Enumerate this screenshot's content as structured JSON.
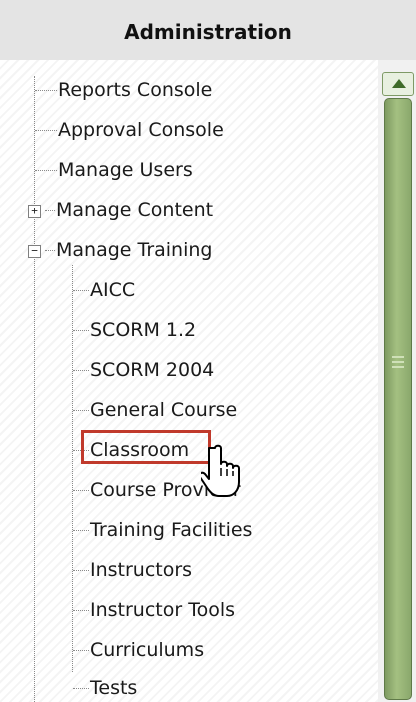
{
  "panel": {
    "title": "Administration"
  },
  "tree": {
    "items": [
      {
        "label": "Reports Console"
      },
      {
        "label": "Approval Console"
      },
      {
        "label": "Manage Users"
      },
      {
        "label": "Manage Content",
        "expander": "+"
      },
      {
        "label": "Manage Training",
        "expander": "−"
      },
      {
        "label": "AICC"
      },
      {
        "label": "SCORM 1.2"
      },
      {
        "label": "SCORM 2004"
      },
      {
        "label": "General Course"
      },
      {
        "label": "Classroom",
        "selected": true
      },
      {
        "label": "Course Provider"
      },
      {
        "label": "Training Facilities"
      },
      {
        "label": "Instructors"
      },
      {
        "label": "Instructor Tools"
      },
      {
        "label": "Curriculums"
      },
      {
        "label": "Tests"
      }
    ]
  },
  "scrollbar": {
    "up_icon": "scroll-up-arrow-icon"
  },
  "cursor": {
    "icon": "hand-pointer-icon"
  }
}
